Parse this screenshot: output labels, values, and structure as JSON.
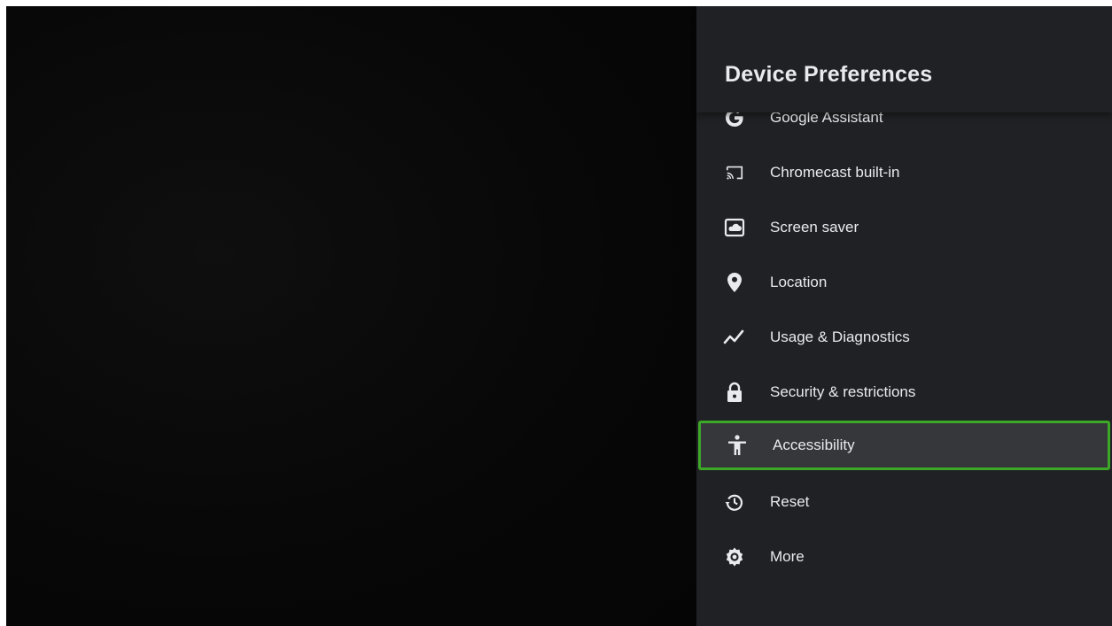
{
  "panel": {
    "title": "Device Preferences",
    "items": [
      {
        "label": "Google Assistant",
        "icon": "google-g-icon"
      },
      {
        "label": "Chromecast built-in",
        "icon": "cast-icon"
      },
      {
        "label": "Screen saver",
        "icon": "screen-saver-icon"
      },
      {
        "label": "Location",
        "icon": "location-pin-icon"
      },
      {
        "label": "Usage & Diagnostics",
        "icon": "diagnostics-graph-icon"
      },
      {
        "label": "Security & restrictions",
        "icon": "lock-icon"
      },
      {
        "label": "Accessibility",
        "icon": "accessibility-icon",
        "focused": true
      },
      {
        "label": "Reset",
        "icon": "reset-history-icon"
      },
      {
        "label": "More",
        "icon": "gear-icon"
      }
    ]
  },
  "colors": {
    "panel_bg": "#202124",
    "focus_border": "#3da827",
    "focus_bg": "#36373b",
    "text": "#e8eaed"
  }
}
